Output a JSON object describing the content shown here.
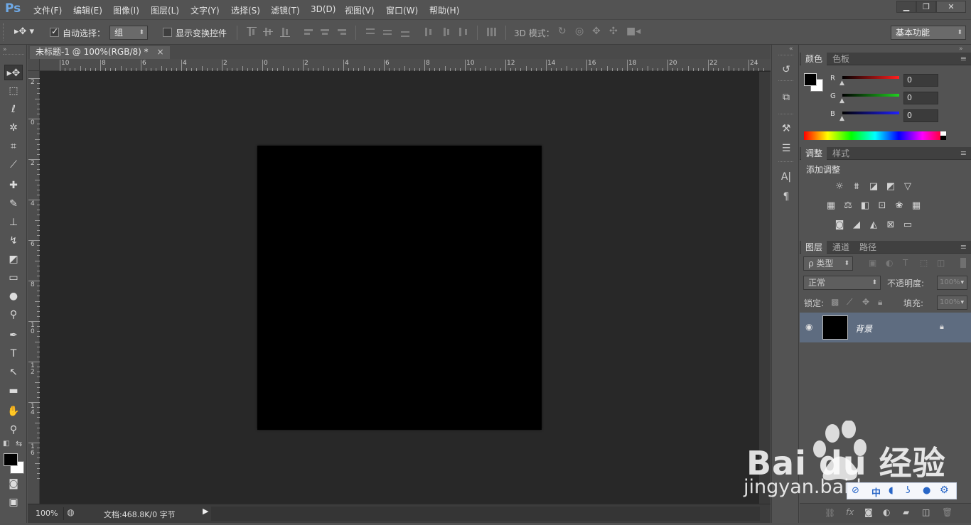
{
  "app": {
    "logo": "Ps"
  },
  "menu": [
    "文件(F)",
    "编辑(E)",
    "图像(I)",
    "图层(L)",
    "文字(Y)",
    "选择(S)",
    "滤镜(T)",
    "3D(D)",
    "视图(V)",
    "窗口(W)",
    "帮助(H)"
  ],
  "window_controls": {
    "minimize": "▁",
    "restore": "❐",
    "close": "✕"
  },
  "options": {
    "auto_select_label": "自动选择：",
    "auto_select_value": "组",
    "show_transform_label": "显示变换控件",
    "mode_3d_label": "3D 模式：",
    "workspace": "基本功能"
  },
  "document": {
    "tab_title": "未标题-1 @ 100%(RGB/8) *",
    "tab_close": "×",
    "zoom": "100%",
    "doc_info": "文档:468.8K/0 字节",
    "ruler_top": [
      "10",
      "8",
      "6",
      "4",
      "2",
      "0",
      "2",
      "4",
      "6",
      "8",
      "10",
      "12",
      "14",
      "16",
      "18",
      "20",
      "22",
      "24"
    ],
    "ruler_left": [
      "2",
      "0",
      "2",
      "4",
      "6",
      "8",
      "1\n0",
      "1\n2",
      "1\n4",
      "1\n6"
    ]
  },
  "color_panel": {
    "tabs": [
      "颜色",
      "色板"
    ],
    "channels": [
      {
        "label": "R",
        "value": "0",
        "color": "#ff2020"
      },
      {
        "label": "G",
        "value": "0",
        "color": "#20d020"
      },
      {
        "label": "B",
        "value": "0",
        "color": "#2020ff"
      }
    ]
  },
  "adjust_panel": {
    "tabs": [
      "调整",
      "样式"
    ],
    "add_adjust": "添加调整",
    "icons_row1": [
      "brightness-icon",
      "levels-icon",
      "curves-icon",
      "exposure-icon",
      "vibrance-icon"
    ],
    "icons_row2": [
      "hue-saturation-icon",
      "color-balance-icon",
      "black-white-icon",
      "photo-filter-icon",
      "channel-mixer-icon",
      "color-lookup-icon"
    ],
    "icons_row3": [
      "invert-icon",
      "posterize-icon",
      "threshold-icon",
      "selective-color-icon",
      "gradient-map-icon"
    ]
  },
  "layers_panel": {
    "tabs": [
      "图层",
      "通道",
      "路径"
    ],
    "filter_kind": "ρ 类型",
    "blend_mode": "正常",
    "opacity_label": "不透明度:",
    "opacity_value": "100%",
    "lock_label": "锁定:",
    "fill_label": "填充:",
    "fill_value": "100%",
    "layers": [
      {
        "name": "背景",
        "locked": true,
        "visible": true
      }
    ],
    "bottom_icons": [
      "link-icon",
      "fx-icon",
      "mask-icon",
      "adjustment-icon",
      "folder-icon",
      "new-layer-icon",
      "trash-icon"
    ]
  },
  "watermark": {
    "brand": "Bai du 经验",
    "url": "jingyan.baidu.com"
  },
  "ime_bar": {
    "lang": "中"
  }
}
